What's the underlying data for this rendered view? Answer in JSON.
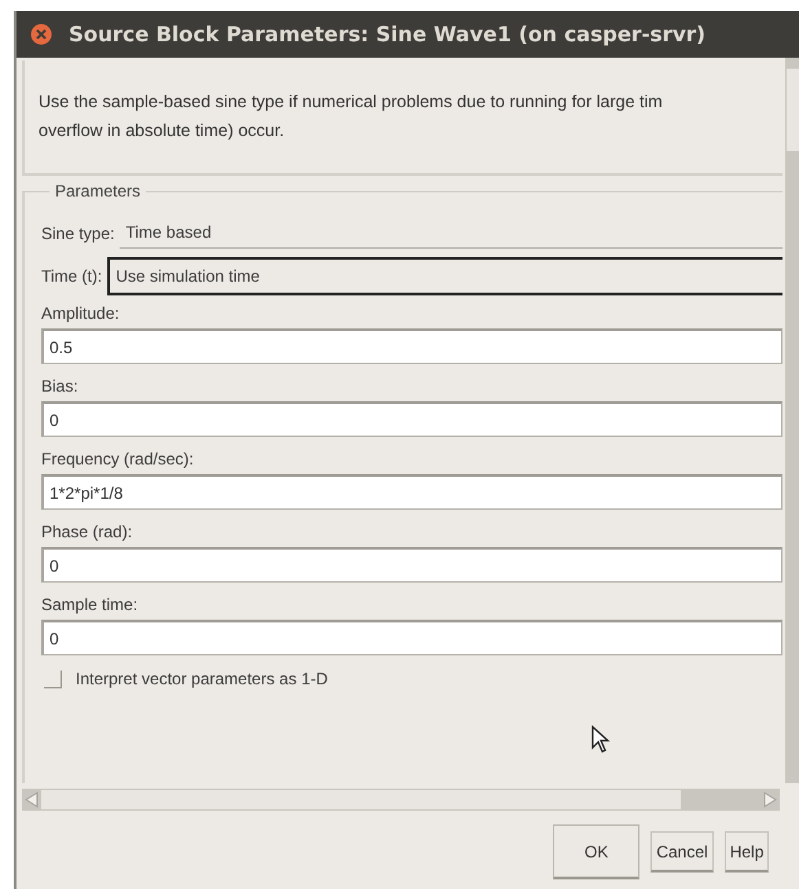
{
  "window": {
    "title": "Source Block Parameters: Sine Wave1 (on casper-srvr)"
  },
  "description": "Use the sample-based sine type if numerical problems due to running for large tim",
  "description_line_2": "overflow in absolute time) occur.",
  "parameters": {
    "legend": "Parameters",
    "sine_type": {
      "label": "Sine type:",
      "value": "Time based"
    },
    "time": {
      "label": "Time (t):",
      "value": "Use simulation time"
    },
    "fields": [
      {
        "label": "Amplitude:",
        "value": "0.5"
      },
      {
        "label": "Bias:",
        "value": "0"
      },
      {
        "label": "Frequency (rad/sec):",
        "value": "1*2*pi*1/8"
      },
      {
        "label": "Phase (rad):",
        "value": "0"
      },
      {
        "label": "Sample time:",
        "value": "0"
      }
    ],
    "checkbox": {
      "label": "Interpret vector parameters as 1-D",
      "checked": false
    }
  },
  "buttons": [
    {
      "label": "OK",
      "kind": "default"
    },
    {
      "label": "Cancel",
      "kind": "normal"
    },
    {
      "label": "Help",
      "kind": "normal"
    }
  ]
}
